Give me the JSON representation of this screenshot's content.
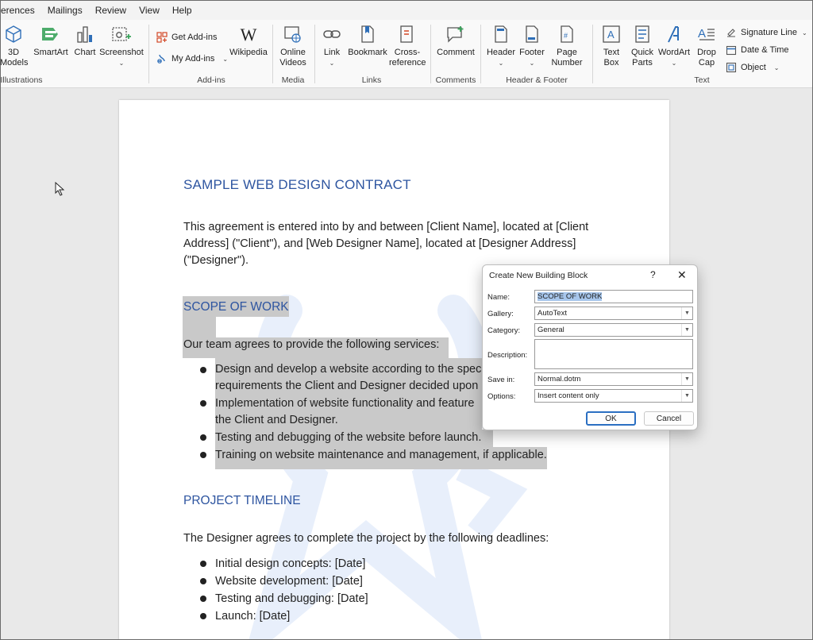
{
  "tabs": [
    "erences",
    "Mailings",
    "Review",
    "View",
    "Help"
  ],
  "ribbon": {
    "illustrations": {
      "models_label": "3D Models",
      "smartart_label": "SmartArt",
      "chart_label": "Chart",
      "screenshot_label": "Screenshot",
      "group_label": "Illustrations"
    },
    "addins": {
      "get_addins": "Get Add-ins",
      "my_addins": "My Add-ins",
      "wikipedia": "Wikipedia",
      "group_label": "Add-ins"
    },
    "media": {
      "online_videos": "Online Videos",
      "group_label": "Media"
    },
    "links": {
      "link": "Link",
      "bookmark": "Bookmark",
      "cross_reference": "Cross-reference",
      "group_label": "Links"
    },
    "comments": {
      "comment": "Comment",
      "group_label": "Comments"
    },
    "header_footer": {
      "header": "Header",
      "footer": "Footer",
      "page_number": "Page Number",
      "group_label": "Header & Footer"
    },
    "text": {
      "text_box": "Text Box",
      "quick_parts": "Quick Parts",
      "wordart": "WordArt",
      "drop_cap": "Drop Cap",
      "signature_line": "Signature Line",
      "date_time": "Date & Time",
      "object": "Object",
      "group_label": "Text"
    }
  },
  "document": {
    "title": "SAMPLE WEB DESIGN CONTRACT",
    "intro_lines": [
      "This agreement is entered into by and between [Client Name], located at [Client",
      "Address] (\"Client\"), and [Web Designer Name], located at [Designer Address]",
      "(\"Designer\")."
    ],
    "scope_heading": "SCOPE OF WORK",
    "scope_intro": "Our team agrees to provide the following services:",
    "scope_bullets": [
      "Design and develop a website according to the spec",
      "requirements the Client and Designer decided upon",
      "Implementation of website functionality and feature",
      "the Client and Designer.",
      "Testing and debugging of the website before launch.",
      "Training on website maintenance and management, if applicable."
    ],
    "timeline_heading": "PROJECT TIMELINE",
    "timeline_intro": "The Designer agrees to complete the project by the following deadlines:",
    "timeline_bullets": [
      "Initial design concepts: [Date]",
      "Website development: [Date]",
      "Testing and debugging: [Date]",
      "Launch: [Date]"
    ]
  },
  "dialog": {
    "title": "Create New Building Block",
    "help": "?",
    "close": "✕",
    "name_label": "Name:",
    "name_value": "SCOPE OF WORK",
    "gallery_label": "Gallery:",
    "gallery_value": "AutoText",
    "category_label": "Category:",
    "category_value": "General",
    "description_label": "Description:",
    "save_in_label": "Save in:",
    "save_in_value": "Normal.dotm",
    "options_label": "Options:",
    "options_value": "Insert content only",
    "ok_label": "OK",
    "cancel_label": "Cancel"
  },
  "colors": {
    "heading": "#2e55a0",
    "selection": "#c9c9c9",
    "dialog_selection": "#a7c6ec",
    "ok_border": "#2b6fc2"
  }
}
